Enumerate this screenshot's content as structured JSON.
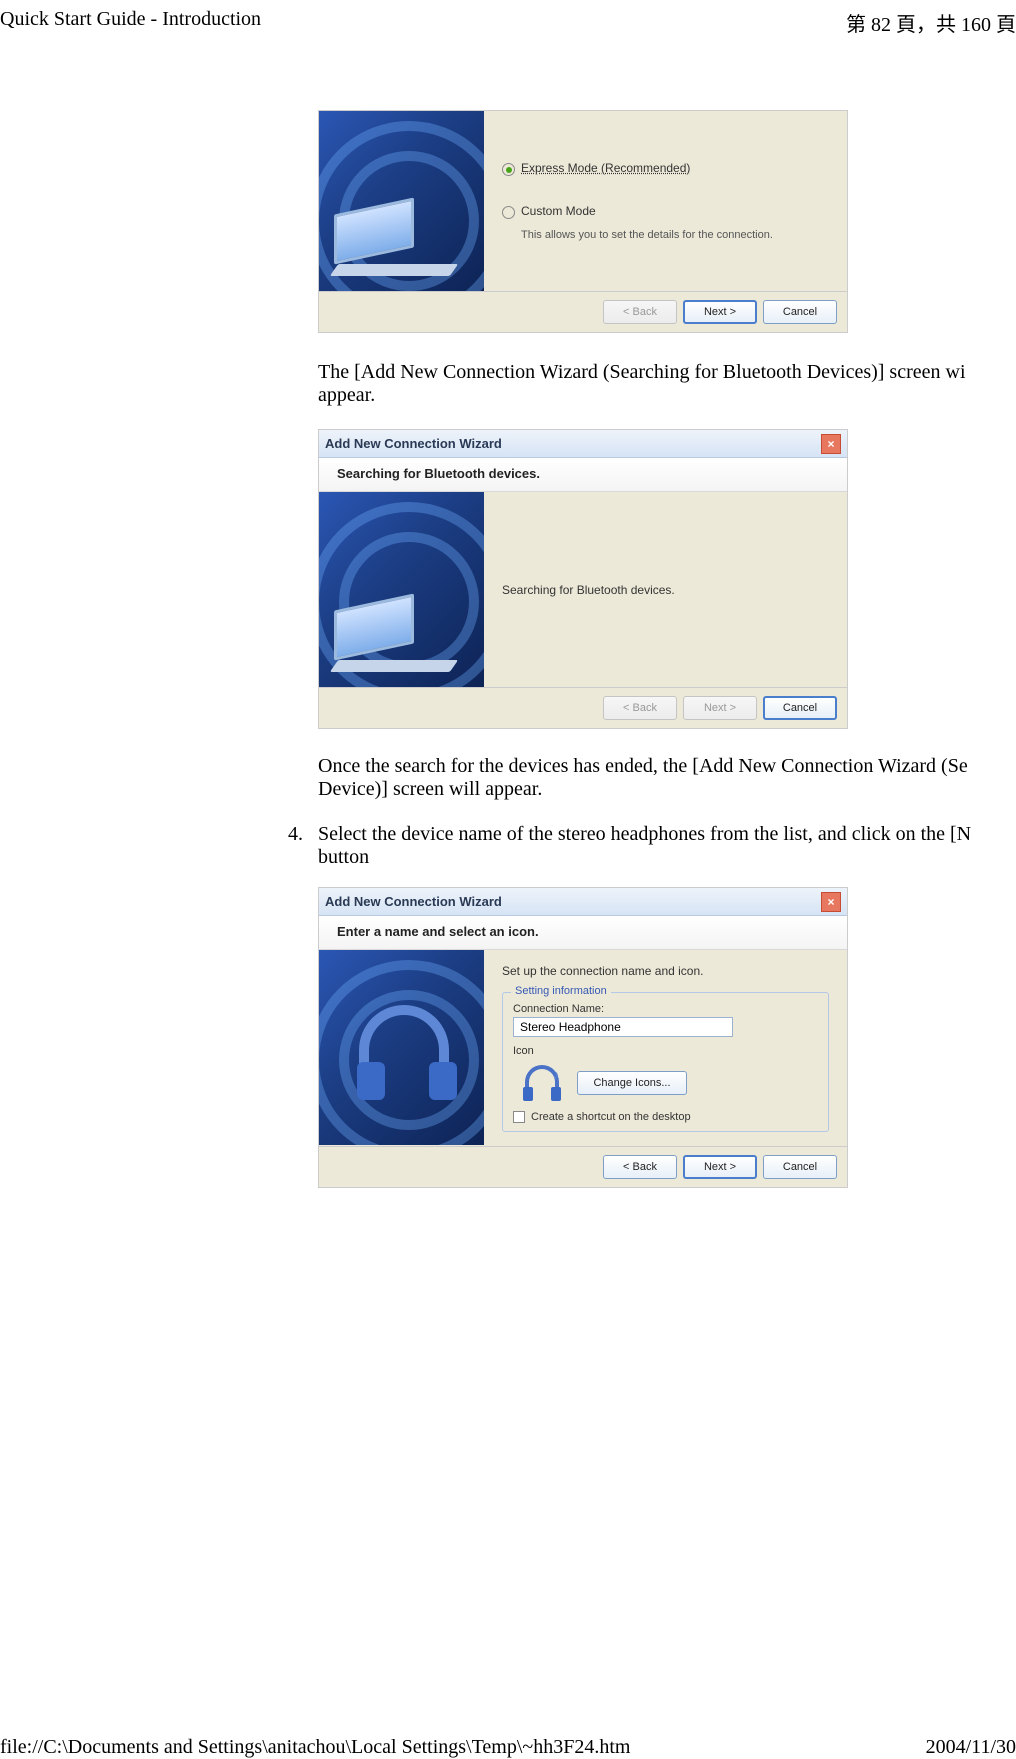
{
  "header": {
    "title": "Quick Start Guide - Introduction",
    "page_text": "第 82 頁，共 160 頁"
  },
  "footer": {
    "path": "file://C:\\Documents and Settings\\anitachou\\Local Settings\\Temp\\~hh3F24.htm",
    "date": "2004/11/30"
  },
  "dialog1": {
    "radio_express": "Express Mode (Recommended)",
    "radio_custom": "Custom Mode",
    "custom_desc": "This allows you to set the details for the connection.",
    "back": "< Back",
    "next": "Next >",
    "cancel": "Cancel"
  },
  "para1": "The [Add New Connection Wizard (Searching for Bluetooth Devices)] screen wi appear.",
  "dialog2": {
    "title": "Add New Connection Wizard",
    "subhead": "Searching for Bluetooth devices.",
    "status": "Searching for Bluetooth devices.",
    "back": "< Back",
    "next": "Next >",
    "cancel": "Cancel"
  },
  "para2": "Once the search for the devices has ended, the [Add New Connection Wizard (Se Device)] screen will appear.",
  "step4_num": "4.",
  "step4_text": "Select the device name of the stereo headphones from the list, and click on the [N button",
  "dialog3": {
    "title": "Add New Connection Wizard",
    "subhead": "Enter a name and select an icon.",
    "intro": "Set up the connection name and icon.",
    "legend": "Setting information",
    "conn_label": "Connection Name:",
    "conn_value": "Stereo Headphone",
    "icon_label": "Icon",
    "change_icons": "Change Icons...",
    "shortcut": "Create a shortcut on the desktop",
    "back": "< Back",
    "next": "Next >",
    "cancel": "Cancel"
  }
}
